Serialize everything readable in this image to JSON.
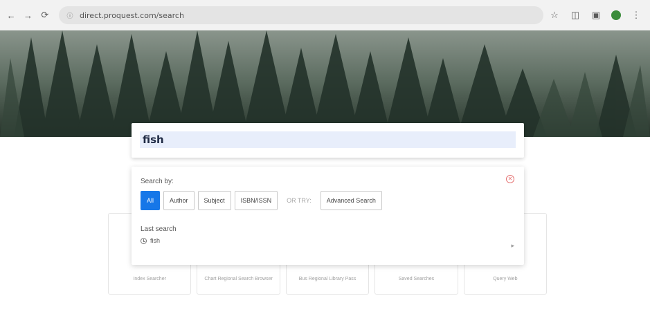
{
  "browser": {
    "url": "direct.proquest.com/search",
    "nav": {
      "back": "←",
      "forward": "→",
      "reload": "⟳"
    },
    "icons": [
      "star-icon",
      "extensions-icon",
      "sidepanel-icon",
      "profile-avatar",
      "menu-icon"
    ]
  },
  "search": {
    "value": "fish"
  },
  "panel": {
    "search_by_label": "Search by:",
    "filters": [
      {
        "label": "All",
        "active": true
      },
      {
        "label": "Author",
        "active": false
      },
      {
        "label": "Subject",
        "active": false
      },
      {
        "label": "ISBN/ISSN",
        "active": false
      }
    ],
    "or_try_label": "OR TRY:",
    "advanced_label": "Advanced Search",
    "last_search_label": "Last search",
    "last_search_item": "fish"
  },
  "cards": [
    {
      "label": "Index Searcher"
    },
    {
      "label": "Chart Regional Search Browser"
    },
    {
      "label": "Bus Regional Library Pass"
    },
    {
      "label": "Saved Searches"
    },
    {
      "label": "Query Web"
    }
  ],
  "colors": {
    "accent": "#1677e8",
    "input_bg": "#e8eefb",
    "close": "#e57373"
  }
}
